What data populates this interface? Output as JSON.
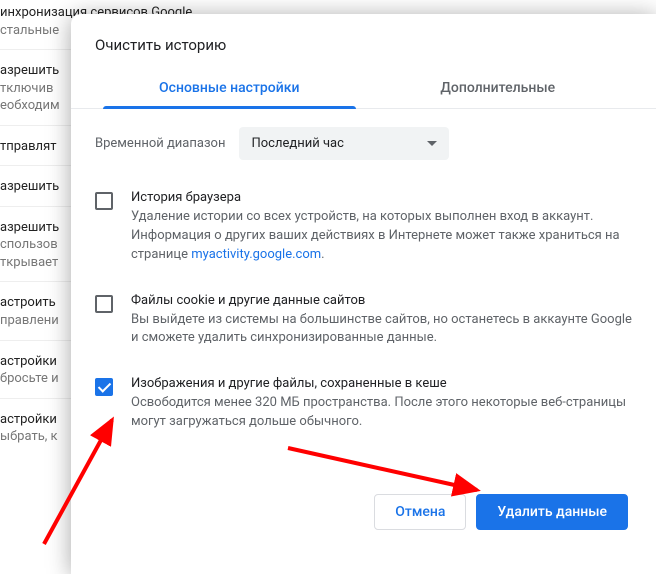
{
  "background": {
    "rows": [
      {
        "title": "инхронизация сервисов Google",
        "sub": "стальные"
      },
      {
        "title": "азрешить",
        "sub": "тключив\nеобходим"
      },
      {
        "title": "тправлят",
        "sub": ""
      },
      {
        "title": "азрешить",
        "sub": ""
      },
      {
        "title": "азрешить",
        "sub": "спользов\nткрывает"
      },
      {
        "title": "астроить",
        "sub": "правлени"
      },
      {
        "title": "астройки",
        "sub": "бросьте и"
      },
      {
        "title": "астройки",
        "sub": "ыбрать, к"
      }
    ]
  },
  "dialog": {
    "title": "Очистить историю",
    "tabs": {
      "basic": "Основные настройки",
      "advanced": "Дополнительные"
    },
    "timeRange": {
      "label": "Временной диапазон",
      "value": "Последний час"
    },
    "options": [
      {
        "checked": false,
        "title": "История браузера",
        "desc_before": "Удаление истории со всех устройств, на которых выполнен вход в аккаунт. Информация о других ваших действиях в Интернете может также храниться на странице ",
        "link": "myactivity.google.com",
        "desc_after": "."
      },
      {
        "checked": false,
        "title": "Файлы cookie и другие данные сайтов",
        "desc": "Вы выйдете из системы на большинстве сайтов, но останетесь в аккаунте Google и сможете удалить синхронизированные данные."
      },
      {
        "checked": true,
        "title": "Изображения и другие файлы, сохраненные в кеше",
        "desc": "Освободится менее 320 МБ пространства. После этого некоторые веб-страницы могут загружаться дольше обычного."
      }
    ],
    "buttons": {
      "cancel": "Отмена",
      "confirm": "Удалить данные"
    }
  }
}
